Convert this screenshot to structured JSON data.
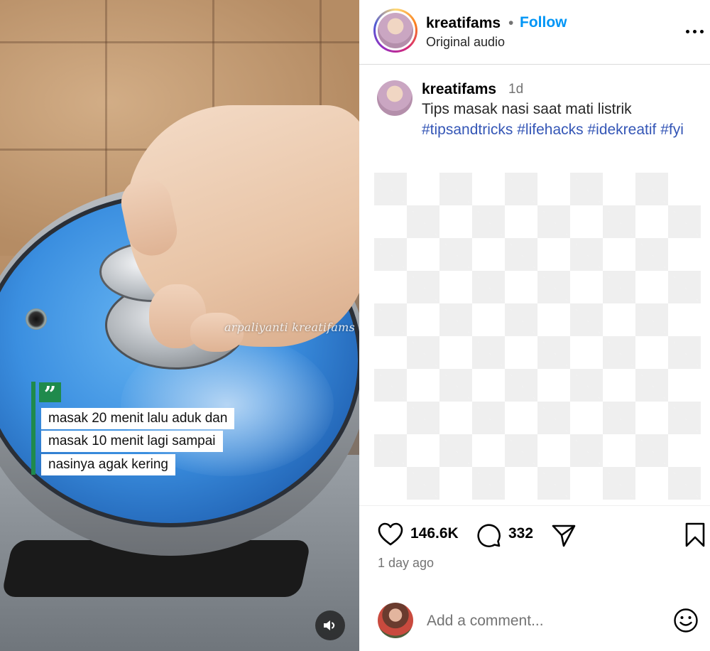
{
  "video": {
    "watermark": "arpaliyanti kreatifams",
    "caption_lines": [
      "masak 20 menit lalu aduk dan",
      "masak 10 menit lagi sampai",
      "nasinya agak kering"
    ],
    "quote_mark": "”",
    "sound_icon": "speaker-icon"
  },
  "header": {
    "username": "kreatifams",
    "separator": "•",
    "follow_label": "Follow",
    "audio_label": "Original audio",
    "more_icon": "more-options-icon"
  },
  "caption": {
    "username": "kreatifams",
    "time": "1d",
    "text": "Tips masak nasi saat mati listrik",
    "hashtags": [
      "#tipsandtricks",
      "#lifehacks",
      "#idekreatif",
      "#fyi"
    ]
  },
  "actions": {
    "like_icon": "heart-icon",
    "like_count": "146.6K",
    "comment_icon": "comment-icon",
    "comment_count": "332",
    "share_icon": "share-icon",
    "save_icon": "bookmark-icon",
    "posted_ago": "1 day ago"
  },
  "comment_box": {
    "placeholder": "Add a comment...",
    "emoji_icon": "emoji-icon"
  },
  "colors": {
    "follow": "#0095f6",
    "hashtag": "#3456b6",
    "quote_accent": "#1f8a4c",
    "muted": "#737373"
  }
}
